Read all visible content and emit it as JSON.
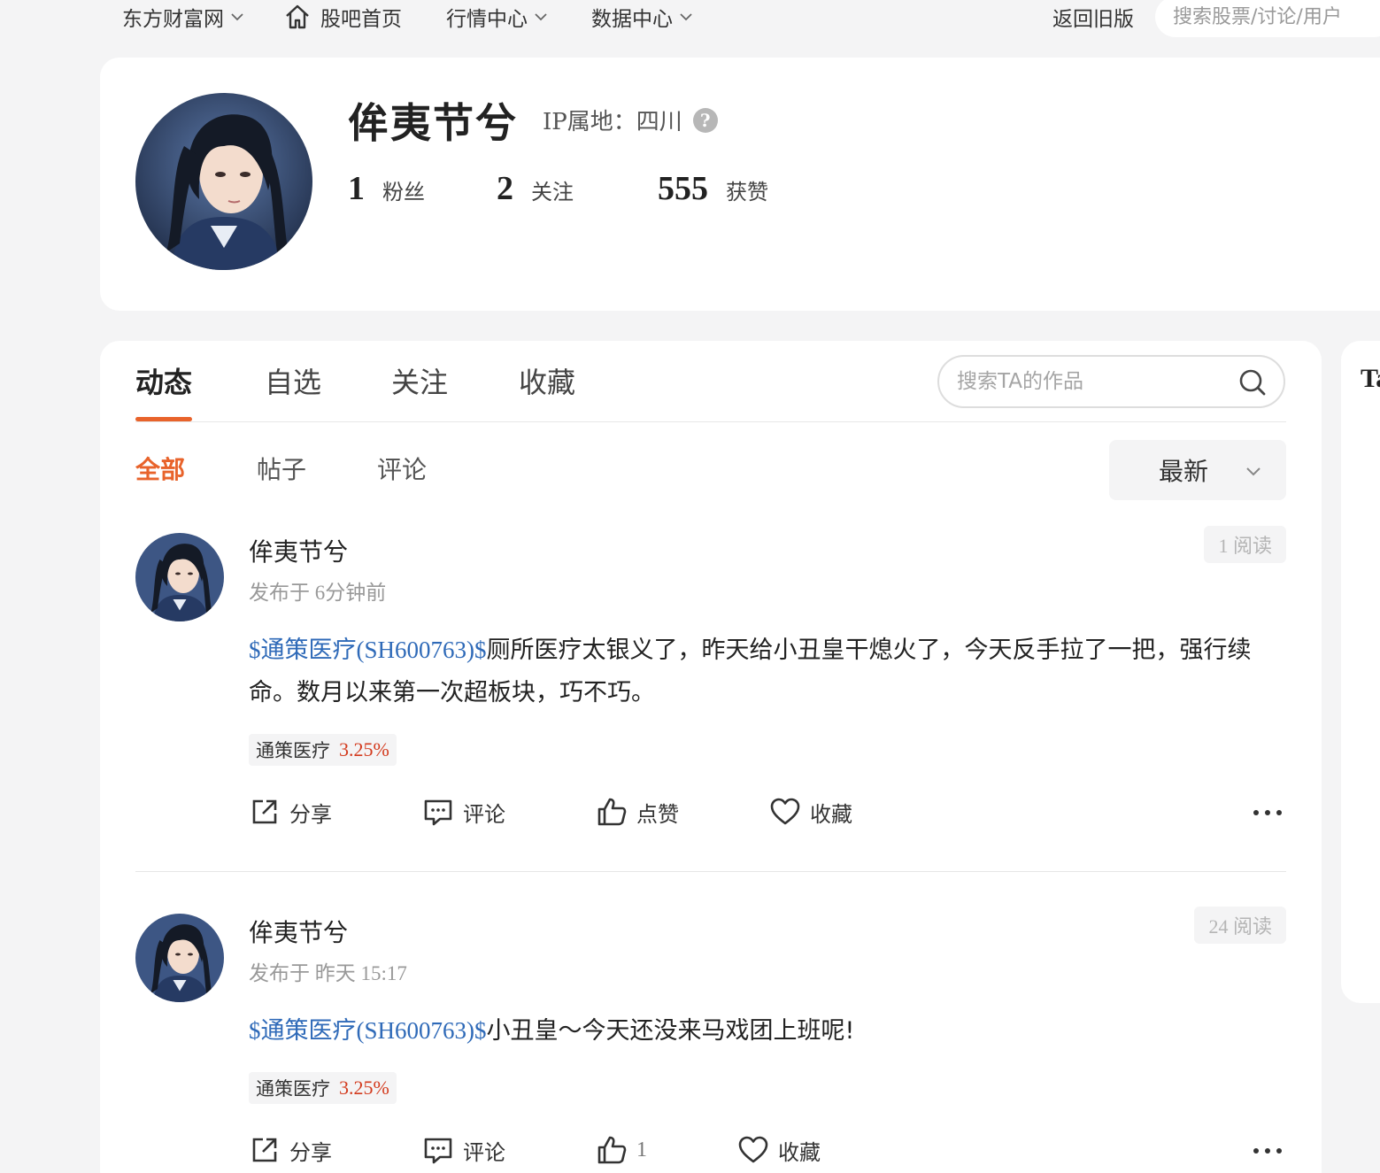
{
  "topnav": {
    "site": "东方财富网",
    "home": "股吧首页",
    "market": "行情中心",
    "data_center": "数据中心",
    "old_version": "返回旧版",
    "search_placeholder": "搜索股票/讨论/用户"
  },
  "profile": {
    "name": "侔夷节兮",
    "ip_label": "IP属地：",
    "ip_value": "四川",
    "help": "?",
    "fans_count": "1",
    "fans_label": "粉丝",
    "following_count": "2",
    "following_label": "关注",
    "likes_count": "555",
    "likes_label": "获赞"
  },
  "tabs": [
    "动态",
    "自选",
    "关注",
    "收藏"
  ],
  "ta_search_placeholder": "搜索TA的作品",
  "subtabs": [
    "全部",
    "帖子",
    "评论"
  ],
  "sort_label": "最新",
  "side_title": "Ta",
  "posts": [
    {
      "author": "侔夷节兮",
      "time": "发布于 6分钟前",
      "reads": "1 阅读",
      "stock_tag": "$通策医疗(SH600763)$",
      "text": "厕所医疗太银义了，昨天给小丑皇干熄火了，今天反手拉了一把，强行续命。数月以来第一次超板块，巧不巧。",
      "chip_name": "通策医疗",
      "chip_pct": "3.25%",
      "share": "分享",
      "comment": "评论",
      "like": "点赞",
      "favorite": "收藏"
    },
    {
      "author": "侔夷节兮",
      "time": "发布于 昨天 15:17",
      "reads": "24 阅读",
      "stock_tag": "$通策医疗(SH600763)$",
      "text": "小丑皇～今天还没来马戏团上班呢!",
      "chip_name": "通策医疗",
      "chip_pct": "3.25%",
      "share": "分享",
      "comment": "评论",
      "like": "1",
      "favorite": "收藏"
    }
  ],
  "colors": {
    "accent": "#e8632b",
    "link": "#2f6ab8",
    "rise": "#d33a1d",
    "background": "#f4f4f5"
  }
}
